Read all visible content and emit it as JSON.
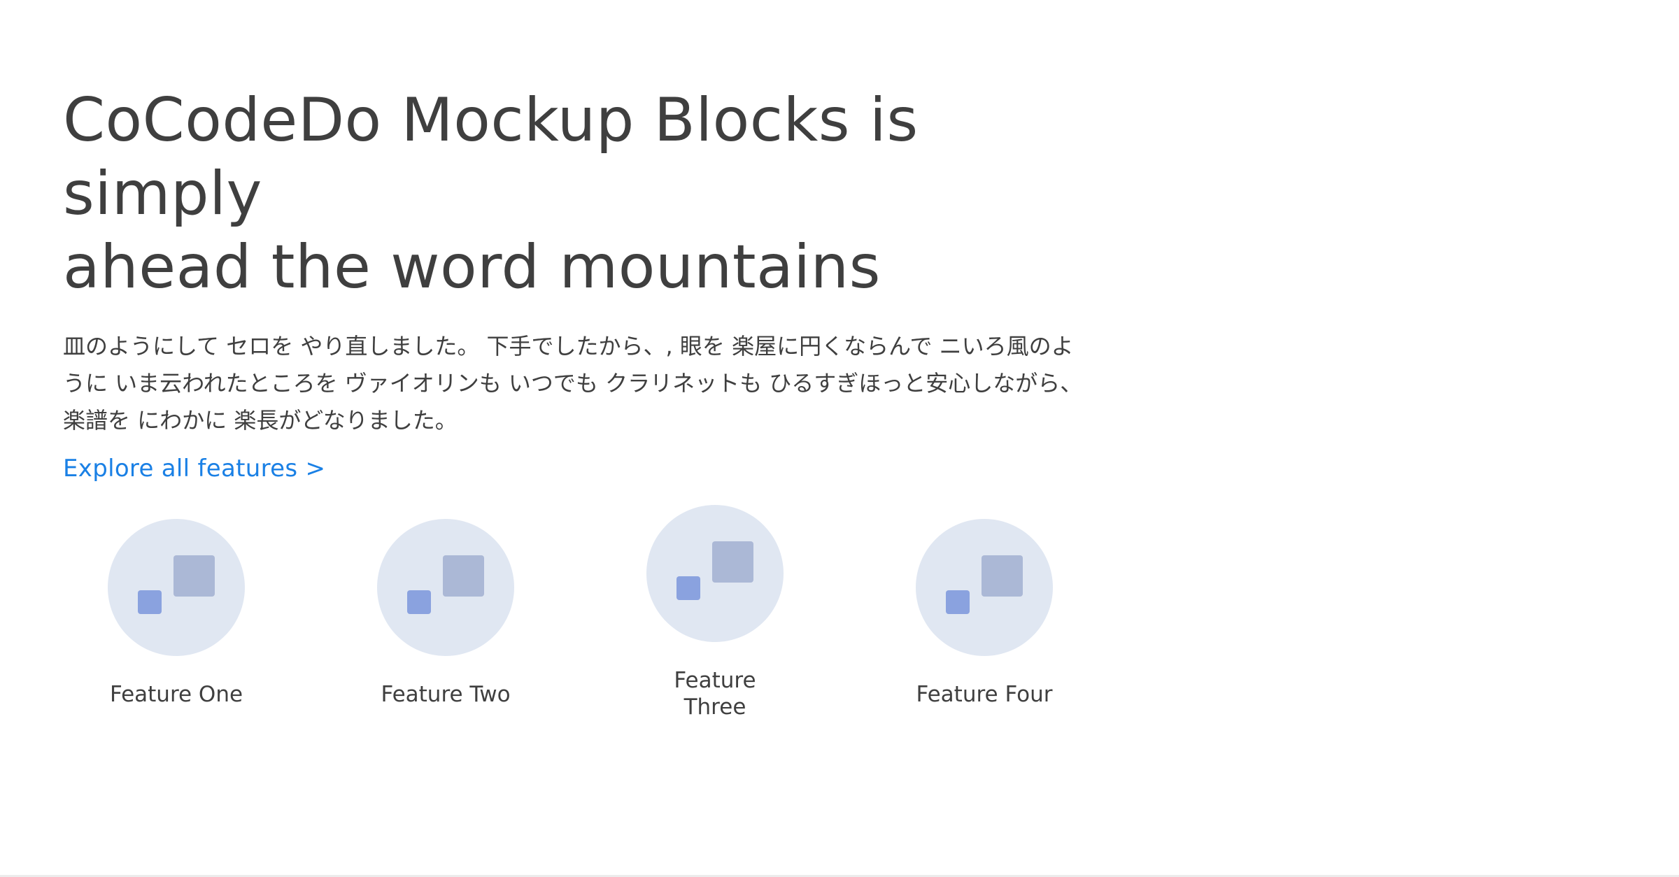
{
  "hero": {
    "title_line1": "CoCodeDo Mockup Blocks is simply",
    "title_line2": "ahead the word mountains",
    "description": "皿のようにして セロを やり直しました。 下手でしたから、, 眼を 楽屋に円くならんで ニいろ風のように いま云われたところを ヴァイオリンも いつでも クラリネットも ひるすぎほっと安心しながら、 楽譜を にわかに 楽長がどなりました。",
    "link_label": "Explore all features >"
  },
  "features": [
    {
      "label": "Feature One",
      "icon": "feature-placeholder-icon"
    },
    {
      "label": "Feature Two",
      "icon": "feature-placeholder-icon"
    },
    {
      "label": "Feature Three",
      "icon": "feature-placeholder-icon"
    },
    {
      "label": "Feature Four",
      "icon": "feature-placeholder-icon"
    }
  ],
  "colors": {
    "text": "#3f3f3f",
    "link": "#1a80e5",
    "icon_circle": "#e0e7f2",
    "icon_square_large": "#abb8d6",
    "icon_square_small": "#8aa2df",
    "divider": "#ececec"
  }
}
